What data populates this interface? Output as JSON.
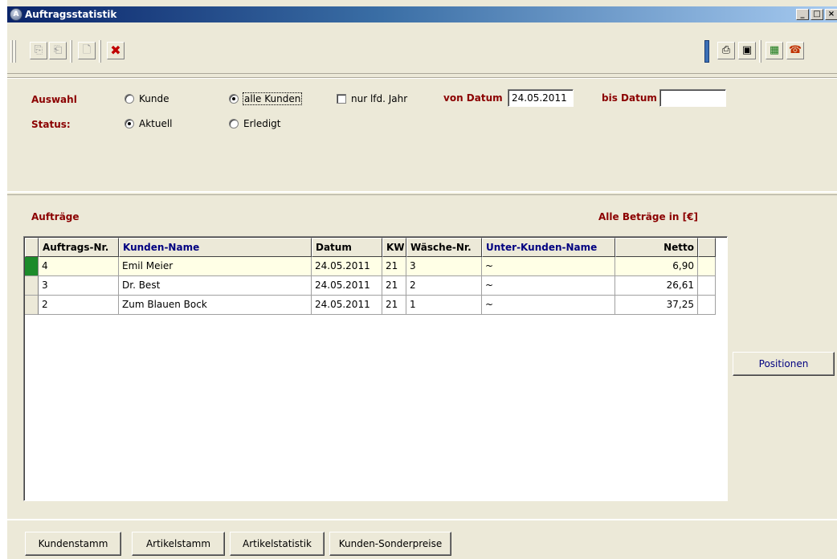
{
  "window": {
    "title": "Auftragsstatistik",
    "controls": [
      "_",
      "□",
      "×"
    ]
  },
  "toolbar": {
    "left_buttons": [
      {
        "name": "copy-icon",
        "glyph": "⎘"
      },
      {
        "name": "paste-icon",
        "glyph": "⎗"
      },
      {
        "name": "new-document-icon",
        "glyph": "🗋"
      },
      {
        "name": "delete-icon",
        "glyph": "✖"
      }
    ],
    "right_buttons": [
      {
        "name": "print-icon",
        "glyph": "⎙"
      },
      {
        "name": "preview-icon",
        "glyph": "▣"
      },
      {
        "name": "calculator-icon",
        "glyph": "▦"
      },
      {
        "name": "phone-icon",
        "glyph": "☎"
      }
    ]
  },
  "filter": {
    "auswahl_label": "Auswahl",
    "status_label": "Status:",
    "kunde_label": "Kunde",
    "alle_kunden_label": "alle Kunden",
    "nur_jahr_label": "nur lfd. Jahr",
    "von_datum_label": "von Datum",
    "von_datum_value": "24.05.2011",
    "bis_datum_label": "bis Datum",
    "bis_datum_value": "",
    "aktuell_label": "Aktuell",
    "erledigt_label": "Erledigt"
  },
  "orders": {
    "section_label": "Aufträge",
    "currency_note": "Alle Beträge in [€]",
    "columns": [
      "Auftrags-Nr.",
      "Kunden-Name",
      "Datum",
      "KW",
      "Wäsche-Nr.",
      "Unter-Kunden-Name",
      "Netto"
    ],
    "rows": [
      {
        "nr": "4",
        "kunde": "Emil Meier",
        "datum": "24.05.2011",
        "kw": "21",
        "waesche": "3",
        "unterkunde": "~",
        "netto": "6,90"
      },
      {
        "nr": "3",
        "kunde": "Dr. Best",
        "datum": "24.05.2011",
        "kw": "21",
        "waesche": "2",
        "unterkunde": "~",
        "netto": "26,61"
      },
      {
        "nr": "2",
        "kunde": "Zum Blauen Bock",
        "datum": "24.05.2011",
        "kw": "21",
        "waesche": "1",
        "unterkunde": "~",
        "netto": "37,25"
      }
    ]
  },
  "actions": {
    "positionen": "Positionen",
    "kundenstamm": "Kundenstamm",
    "artikelstamm": "Artikelstamm",
    "artikelstatistik": "Artikelstatistik",
    "kunden_sonderpreise": "Kunden-Sonderpreise"
  },
  "colors": {
    "label_red": "#8b0000",
    "header_blue": "#000080",
    "active_indicator": "#1c8b2a",
    "selected_row": "#ffffe6"
  }
}
